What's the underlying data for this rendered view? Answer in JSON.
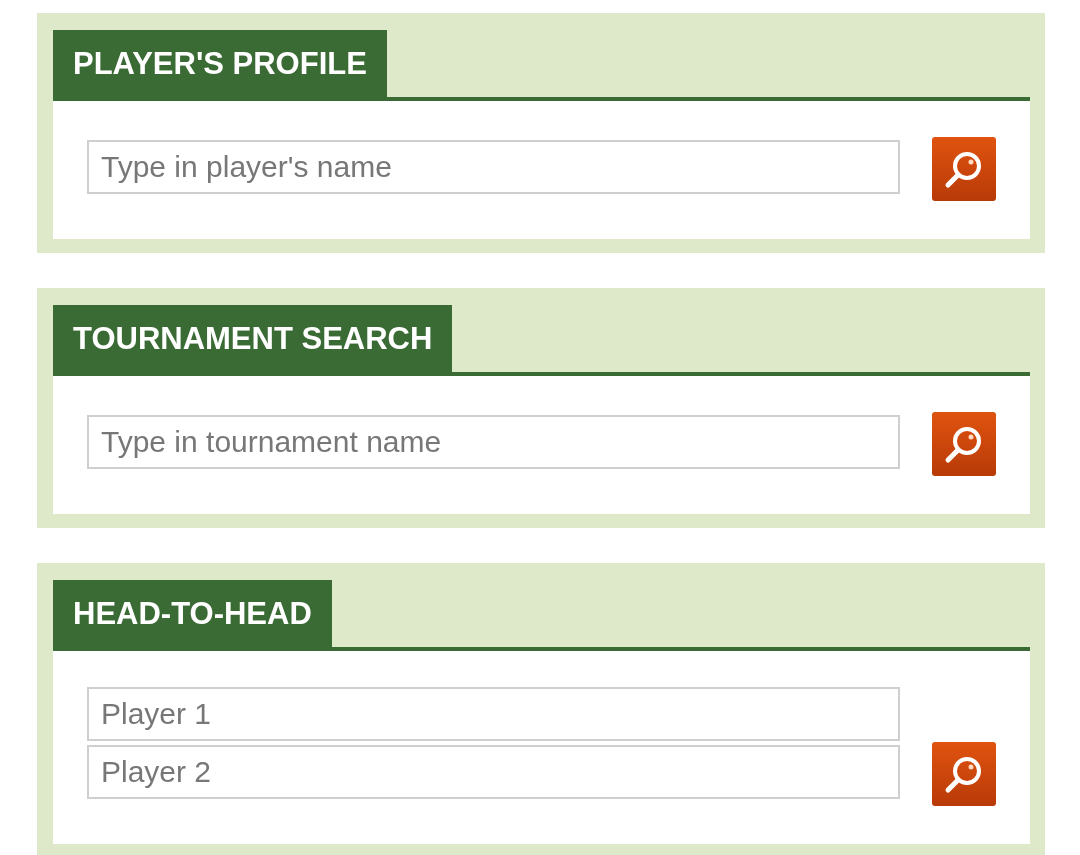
{
  "panels": [
    {
      "title": "PLAYER'S PROFILE",
      "fields": [
        {
          "placeholder": "Type in player's name"
        }
      ]
    },
    {
      "title": "TOURNAMENT SEARCH",
      "fields": [
        {
          "placeholder": "Type in tournament name"
        }
      ]
    },
    {
      "title": "HEAD-TO-HEAD",
      "fields": [
        {
          "placeholder": "Player 1"
        },
        {
          "placeholder": "Player 2"
        }
      ]
    }
  ]
}
